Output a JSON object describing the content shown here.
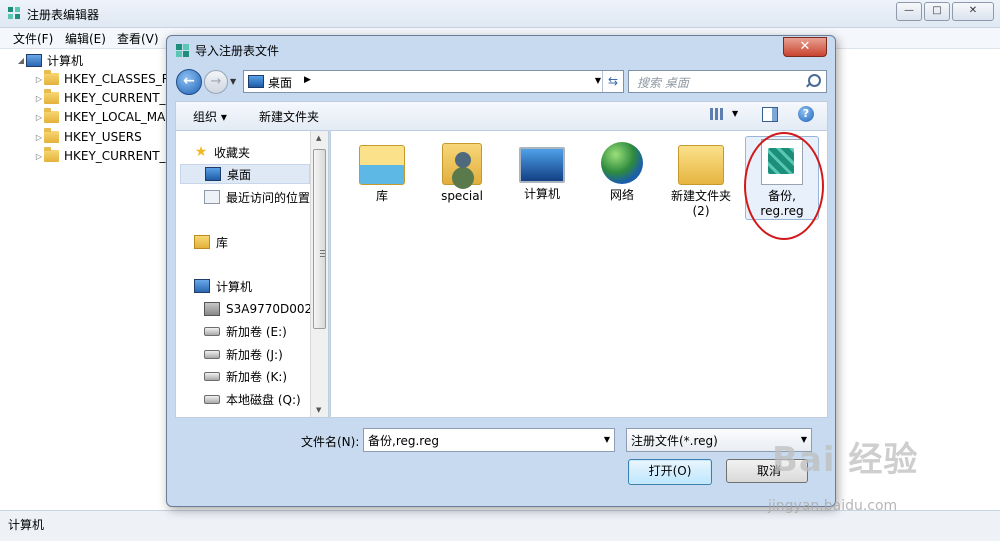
{
  "background_window": {
    "title": "注册表编辑器",
    "menu": [
      "文件(F)",
      "编辑(E)",
      "查看(V)"
    ],
    "tree": {
      "root": "计算机",
      "items": [
        "HKEY_CLASSES_R",
        "HKEY_CURRENT_",
        "HKEY_LOCAL_MA",
        "HKEY_USERS",
        "HKEY_CURRENT_"
      ]
    },
    "status": "计算机",
    "controls": {
      "minimize": "—",
      "maximize": "□",
      "close": "✕"
    }
  },
  "dialog": {
    "title": "导入注册表文件",
    "close": "✕",
    "address": {
      "location": "桌面",
      "separator": "▶"
    },
    "search_placeholder": "搜索 桌面",
    "toolbar": {
      "organize": "组织 ▾",
      "new_folder": "新建文件夹",
      "help": "?"
    },
    "nav": {
      "favorites_header": "收藏夹",
      "favorites": [
        "桌面",
        "最近访问的位置"
      ],
      "libraries": "库",
      "computer": "计算机",
      "drives": [
        "S3A9770D002 (",
        "新加卷 (E:)",
        "新加卷 (J:)",
        "新加卷 (K:)",
        "本地磁盘 (Q:)"
      ]
    },
    "files": [
      {
        "name": "库",
        "icon": "library-icon"
      },
      {
        "name": "special",
        "icon": "user-folder-icon"
      },
      {
        "name": "计算机",
        "icon": "computer-icon"
      },
      {
        "name": "网络",
        "icon": "network-icon"
      },
      {
        "name": "新建文件夹 (2)",
        "icon": "folder-icon"
      },
      {
        "name": "备份, reg.reg",
        "icon": "reg-file-icon"
      }
    ],
    "filename_label": "文件名(N):",
    "filename_value": "备份,reg.reg",
    "filetype_value": "注册文件(*.reg)",
    "open_button": "打开(O)",
    "cancel_button": "取消"
  },
  "watermark": {
    "big": "Bai 经验",
    "small": "jingyan.baidu.com"
  },
  "colors": {
    "highlight_circle": "#d11919",
    "dialog_frame": "#c8daf0"
  }
}
